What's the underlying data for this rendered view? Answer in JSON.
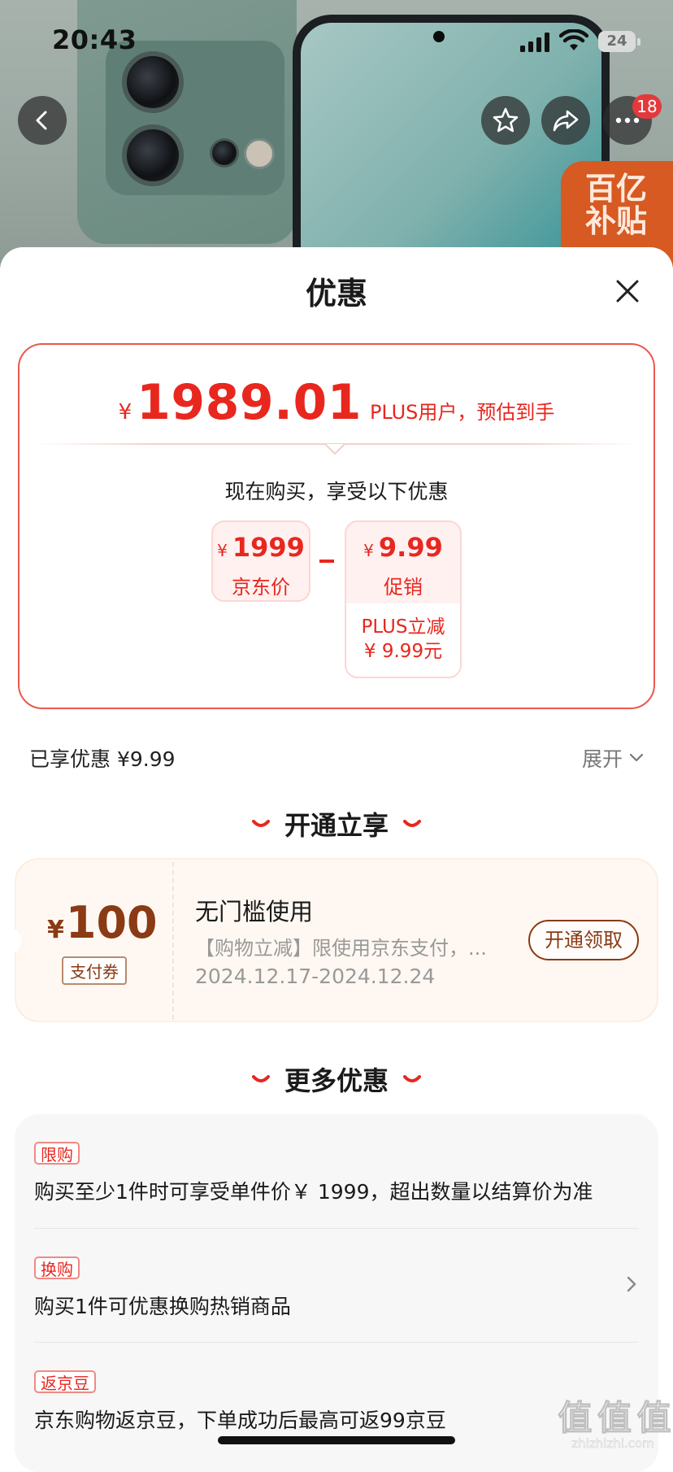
{
  "status_bar": {
    "time": "20:43",
    "battery": "24"
  },
  "nav": {
    "badge_count": "18"
  },
  "promo_badge": {
    "text": "百亿\n补贴"
  },
  "sheet": {
    "title": "优惠"
  },
  "price_card": {
    "currency": "¥",
    "final_price": "1989.01",
    "final_note": "PLUS用户，预估到手",
    "buy_now_text": "现在购买，享受以下优惠",
    "jd_price": {
      "currency": "¥",
      "value": "1999",
      "label": "京东价"
    },
    "promo": {
      "currency": "¥",
      "value": "9.99",
      "label": "促销",
      "detail_line1": "PLUS立减",
      "detail_line2": "¥ 9.99元"
    }
  },
  "enjoyed": {
    "text": "已享优惠 ¥9.99",
    "expand_label": "展开"
  },
  "open_section": {
    "heading": "开通立享"
  },
  "coupon": {
    "currency": "¥",
    "value": "100",
    "type_tag": "支付券",
    "title": "无门槛使用",
    "description": "【购物立减】限使用京东支付，...",
    "date_range": "2024.12.17-2024.12.24",
    "button_label": "开通领取"
  },
  "more_section": {
    "heading": "更多优惠",
    "items": [
      {
        "tag": "限购",
        "text": "购买至少1件时可享受单件价￥ 1999，超出数量以结算价为准"
      },
      {
        "tag": "换购",
        "text": "购买1件可优惠换购热销商品"
      },
      {
        "tag": "返京豆",
        "text": "京东购物返京豆，下单成功后最高可返99京豆"
      }
    ]
  },
  "watermark": {
    "text": "值 值 值",
    "sub": "zhizhizhi.com"
  },
  "icons": [
    "back-icon",
    "star-icon",
    "share-icon",
    "more-icon",
    "close-icon",
    "chevron-down-icon",
    "chevron-right-icon"
  ],
  "colors": {
    "accent": "#e8271f",
    "coupon_brown": "#8a3a14",
    "promo_orange": "#d65a22"
  }
}
